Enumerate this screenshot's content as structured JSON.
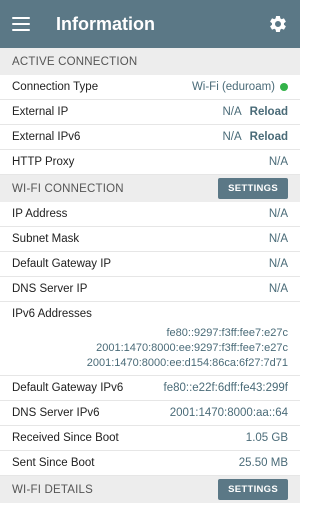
{
  "app_bar": {
    "title": "Information",
    "menu_icon": "menu-icon",
    "settings_icon": "gear-icon"
  },
  "active_connection": {
    "header": "ACTIVE CONNECTION",
    "rows": [
      {
        "label": "Connection Type",
        "value": "Wi-Fi (eduroam)",
        "status_color": "#33b249"
      },
      {
        "label": "External IP",
        "value": "N/A",
        "action": "Reload"
      },
      {
        "label": "External IPv6",
        "value": "N/A",
        "action": "Reload"
      },
      {
        "label": "HTTP Proxy",
        "value": "N/A"
      }
    ]
  },
  "wifi_connection": {
    "header": "WI-FI CONNECTION",
    "button": "SETTINGS",
    "rows": [
      {
        "label": "IP Address",
        "value": "N/A"
      },
      {
        "label": "Subnet Mask",
        "value": "N/A"
      },
      {
        "label": "Default Gateway IP",
        "value": "N/A"
      },
      {
        "label": "DNS Server IP",
        "value": "N/A"
      }
    ],
    "ipv6": {
      "label": "IPv6 Addresses",
      "values": [
        "fe80::9297:f3ff:fee7:e27c",
        "2001:1470:8000:ee:9297:f3ff:fee7:e27c",
        "2001:1470:8000:ee:d154:86ca:6f27:7d71"
      ]
    },
    "rows2": [
      {
        "label": "Default Gateway IPv6",
        "value": "fe80::e22f:6dff:fe43:299f"
      },
      {
        "label": "DNS Server IPv6",
        "value": "2001:1470:8000:aa::64"
      },
      {
        "label": "Received Since Boot",
        "value": "1.05 GB"
      },
      {
        "label": "Sent Since Boot",
        "value": "25.50 MB"
      }
    ]
  },
  "wifi_details": {
    "header": "WI-FI DETAILS",
    "button": "SETTINGS"
  },
  "colors": {
    "accent": "#5b7886",
    "value_text": "#4a6b78",
    "section_bg": "#ededed",
    "status_ok": "#33b249"
  }
}
